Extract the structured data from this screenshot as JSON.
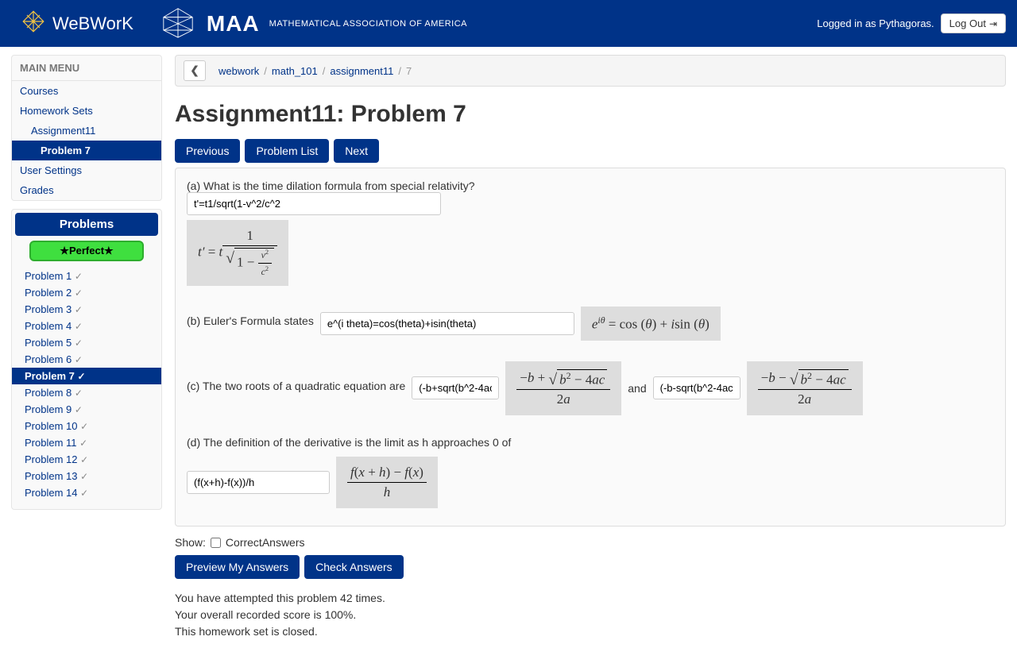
{
  "header": {
    "brand": "WeBWorK",
    "maa_text": "MATHEMATICAL ASSOCIATION OF AMERICA",
    "maa_word": "MAA",
    "logged_in": "Logged in as Pythagoras.",
    "logout": "Log Out"
  },
  "sidebar": {
    "main_menu": "MAIN MENU",
    "items": {
      "courses": "Courses",
      "homework_sets": "Homework Sets",
      "assignment": "Assignment11",
      "problem": "Problem 7",
      "user_settings": "User Settings",
      "grades": "Grades"
    },
    "problems_title": "Problems",
    "perfect": "★Perfect★",
    "problem_list": [
      {
        "label": "Problem 1",
        "done": true,
        "active": false
      },
      {
        "label": "Problem 2",
        "done": true,
        "active": false
      },
      {
        "label": "Problem 3",
        "done": true,
        "active": false
      },
      {
        "label": "Problem 4",
        "done": true,
        "active": false
      },
      {
        "label": "Problem 5",
        "done": true,
        "active": false
      },
      {
        "label": "Problem 6",
        "done": true,
        "active": false
      },
      {
        "label": "Problem 7",
        "done": true,
        "active": true
      },
      {
        "label": "Problem 8",
        "done": true,
        "active": false
      },
      {
        "label": "Problem 9",
        "done": true,
        "active": false
      },
      {
        "label": "Problem 10",
        "done": true,
        "active": false
      },
      {
        "label": "Problem 11",
        "done": true,
        "active": false
      },
      {
        "label": "Problem 12",
        "done": true,
        "active": false
      },
      {
        "label": "Problem 13",
        "done": true,
        "active": false
      },
      {
        "label": "Problem 14",
        "done": true,
        "active": false
      }
    ]
  },
  "breadcrumb": {
    "items": [
      "webwork",
      "math_101",
      "assignment11"
    ],
    "current": "7"
  },
  "page": {
    "title": "Assignment11: Problem 7",
    "nav": {
      "previous": "Previous",
      "problem_list": "Problem List",
      "next": "Next"
    }
  },
  "problem": {
    "a": {
      "text": "(a) What is the time dilation formula from special relativity?",
      "input": "t'=t1/sqrt(1-v^2/c^2"
    },
    "b": {
      "text": "(b) Euler's Formula states",
      "input": "e^(i theta)=cos(theta)+isin(theta)"
    },
    "c": {
      "text": "(c) The two roots of a quadratic equation are",
      "input1": "(-b+sqrt(b^2-4ac))/(2a)",
      "and": "and",
      "input2": "(-b-sqrt(b^2-4ac))/(2a)"
    },
    "d": {
      "text": "(d) The definition of the derivative is the limit as h approaches 0 of",
      "input": "(f(x+h)-f(x))/h"
    }
  },
  "footer": {
    "show": "Show:",
    "correct_answers": "CorrectAnswers",
    "preview": "Preview My Answers",
    "check": "Check Answers",
    "attempts_line1": "You have attempted this problem 42 times.",
    "attempts_line2": "Your overall recorded score is 100%.",
    "attempts_line3": "This homework set is closed."
  }
}
